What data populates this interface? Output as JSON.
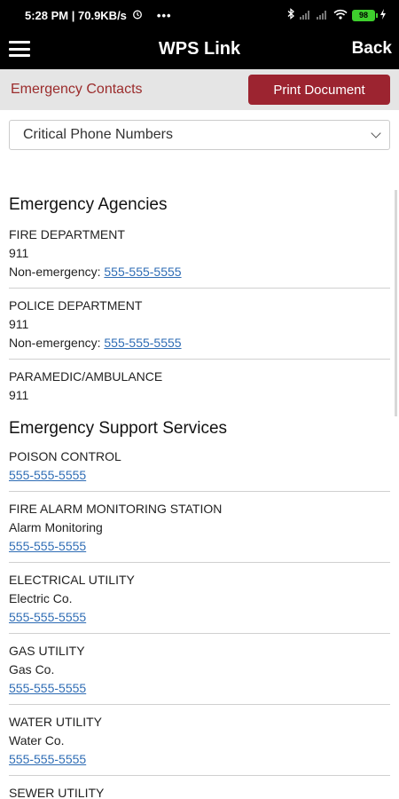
{
  "status_bar": {
    "time_info": "5:28 PM | 70.9KB/s",
    "more": "•••",
    "battery": "98"
  },
  "header": {
    "title": "WPS Link",
    "back_label": "Back"
  },
  "sub_header": {
    "title": "Emergency Contacts",
    "print_label": "Print Document"
  },
  "select": {
    "value": "Critical Phone Numbers"
  },
  "sections": [
    {
      "title": "Emergency Agencies",
      "entries": [
        {
          "name": "FIRE DEPARTMENT",
          "line1": "911",
          "label": "Non-emergency: ",
          "phone": "555-555-5555"
        },
        {
          "name": "POLICE DEPARTMENT",
          "line1": "911",
          "label": "Non-emergency: ",
          "phone": "555-555-5555"
        },
        {
          "name": "PARAMEDIC/AMBULANCE",
          "line1": "911"
        }
      ]
    },
    {
      "title": "Emergency Support Services",
      "entries": [
        {
          "name": "POISON CONTROL",
          "phone": "555-555-5555"
        },
        {
          "name": "FIRE ALARM MONITORING STATION",
          "line1": "Alarm Monitoring",
          "phone": "555-555-5555"
        },
        {
          "name": "ELECTRICAL UTILITY",
          "line1": "Electric Co.",
          "phone": "555-555-5555"
        },
        {
          "name": "GAS UTILITY",
          "line1": "Gas Co.",
          "phone": "555-555-5555"
        },
        {
          "name": "WATER UTILITY",
          "line1": "Water Co.",
          "phone": "555-555-5555"
        },
        {
          "name": "SEWER UTILITY"
        }
      ]
    }
  ]
}
